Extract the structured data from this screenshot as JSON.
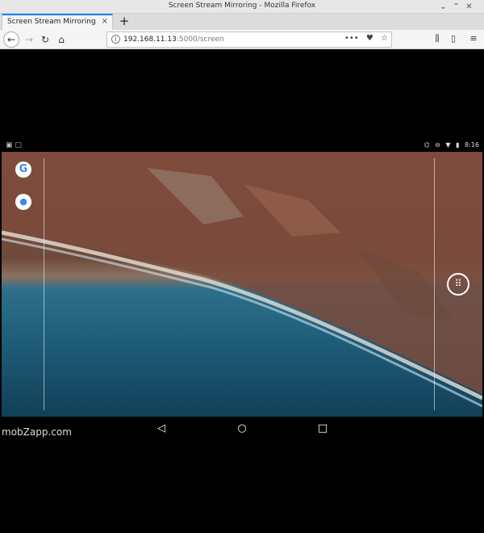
{
  "window": {
    "title": "Screen Stream Mirroring - Mozilla Firefox",
    "controls": [
      "minimize",
      "maximize",
      "close"
    ]
  },
  "tab": {
    "title": "Screen Stream Mirroring",
    "close": "×",
    "new_tab": "+"
  },
  "navbar": {
    "url_host": "192.168.11.13",
    "url_rest": ":5000/screen",
    "page_actions": "•••"
  },
  "device": {
    "status_left": "▣ ▢",
    "status_time": "8:16",
    "status_icons": [
      "cast-icon",
      "dnd-icon",
      "wifi-icon",
      "battery-icon"
    ],
    "watermark": "mobZapp.com"
  },
  "colors": {
    "accent": "#0a84ff",
    "background": "#000000"
  }
}
